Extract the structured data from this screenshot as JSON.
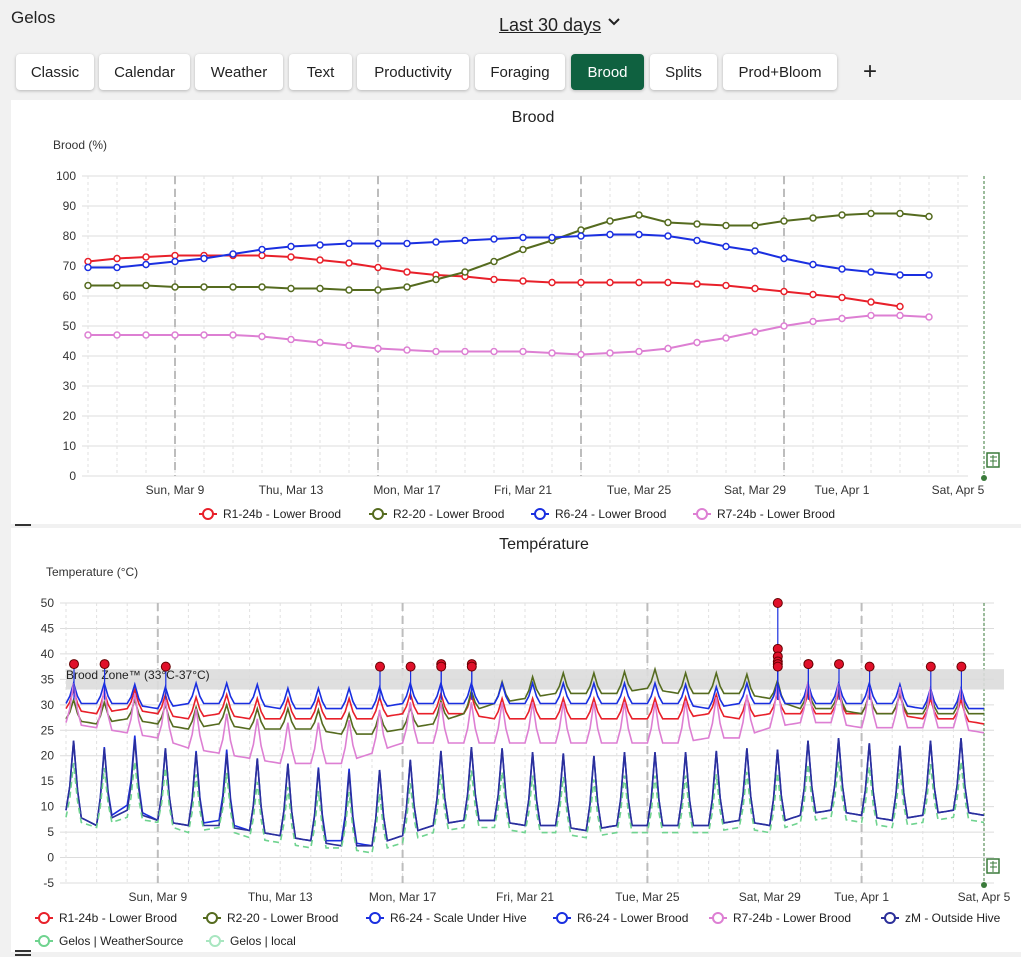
{
  "apiary_name": "Gelos",
  "date_range": {
    "label": "Last 30 days",
    "icon": "chevron-down-icon"
  },
  "tabs": [
    {
      "label": "Classic",
      "active": false
    },
    {
      "label": "Calendar",
      "active": false
    },
    {
      "label": "Weather",
      "active": false
    },
    {
      "label": "Text",
      "active": false
    },
    {
      "label": "Productivity",
      "active": false
    },
    {
      "label": "Foraging",
      "active": false
    },
    {
      "label": "Brood",
      "active": true
    },
    {
      "label": "Splits",
      "active": false
    },
    {
      "label": "Prod+Bloom",
      "active": false
    }
  ],
  "add_tab_icon": "plus-icon",
  "colors": {
    "active_tab": "#0f6140",
    "red": "#e8202a",
    "olive": "#556b1f",
    "blue": "#1a2fe0",
    "pink": "#dd7fd3",
    "navy": "#2b2f9a",
    "lightgreen": "#6fd38f",
    "palegreen": "#a8e6c0"
  },
  "chart_data": [
    {
      "type": "line",
      "title": "Brood",
      "ylabel": "Brood (%)",
      "xlabel": "",
      "ylim": [
        0,
        100
      ],
      "yticks": [
        0,
        10,
        20,
        30,
        40,
        50,
        60,
        70,
        80,
        90,
        100
      ],
      "grid": true,
      "legend_position": "bottom",
      "x_tick_labels": [
        "Sun, Mar 9",
        "Thu, Mar 13",
        "Mon, Mar 17",
        "Fri, Mar 21",
        "Tue, Mar 25",
        "Sat, Mar 29",
        "Tue, Apr 1",
        "Sat, Apr 5"
      ],
      "x": [
        "Mar 6",
        "Mar 7",
        "Mar 8",
        "Mar 9",
        "Mar 10",
        "Mar 11",
        "Mar 12",
        "Mar 13",
        "Mar 14",
        "Mar 15",
        "Mar 16",
        "Mar 17",
        "Mar 18",
        "Mar 19",
        "Mar 20",
        "Mar 21",
        "Mar 22",
        "Mar 23",
        "Mar 24",
        "Mar 25",
        "Mar 26",
        "Mar 27",
        "Mar 28",
        "Mar 29",
        "Mar 30",
        "Mar 31",
        "Apr 1",
        "Apr 2",
        "Apr 3",
        "Apr 4",
        "Apr 5"
      ],
      "series": [
        {
          "name": "R1-24b - Lower Brood",
          "color": "#e8202a",
          "values": [
            71.5,
            72.5,
            73,
            73.5,
            73.5,
            73.5,
            73.5,
            73,
            72,
            71,
            69.5,
            68,
            67,
            66.5,
            65.5,
            65,
            64.5,
            64.5,
            64.5,
            64.5,
            64.5,
            64,
            63.5,
            62.5,
            61.5,
            60.5,
            59.5,
            58,
            56.5,
            null,
            null
          ]
        },
        {
          "name": "R2-20 - Lower Brood",
          "color": "#556b1f",
          "values": [
            63.5,
            63.5,
            63.5,
            63,
            63,
            63,
            63,
            62.5,
            62.5,
            62,
            62,
            63,
            65.5,
            68,
            71.5,
            75.5,
            78.5,
            82,
            85,
            87,
            84.5,
            84,
            83.5,
            83.5,
            85,
            86,
            87,
            87.5,
            87.5,
            86.5,
            null
          ]
        },
        {
          "name": "R6-24 - Lower Brood",
          "color": "#1a2fe0",
          "values": [
            69.5,
            69.5,
            70.5,
            71.5,
            72.5,
            74,
            75.5,
            76.5,
            77,
            77.5,
            77.5,
            77.5,
            78,
            78.5,
            79,
            79.5,
            79.5,
            80,
            80.5,
            80.5,
            80,
            78.5,
            76.5,
            75,
            72.5,
            70.5,
            69,
            68,
            67,
            67,
            null
          ]
        },
        {
          "name": "R7-24b - Lower Brood",
          "color": "#dd7fd3",
          "values": [
            47,
            47,
            47,
            47,
            47,
            47,
            46.5,
            45.5,
            44.5,
            43.5,
            42.5,
            42,
            41.5,
            41.5,
            41.5,
            41.5,
            41,
            40.5,
            41,
            41.5,
            42.5,
            44.5,
            46,
            48,
            50,
            51.5,
            52.5,
            53.5,
            53.5,
            53,
            null
          ]
        }
      ]
    },
    {
      "type": "line",
      "title": "Température",
      "ylabel": "Temperature (°C)",
      "xlabel": "",
      "ylim": [
        -5,
        50
      ],
      "yticks": [
        -5,
        0,
        5,
        10,
        15,
        20,
        25,
        30,
        35,
        40,
        45,
        50
      ],
      "grid": true,
      "legend_position": "bottom",
      "x_tick_labels": [
        "Sun, Mar 9",
        "Thu, Mar 13",
        "Mon, Mar 17",
        "Fri, Mar 21",
        "Tue, Mar 25",
        "Sat, Mar 29",
        "Tue, Apr 1",
        "Sat, Apr 5"
      ],
      "annotation": "Brood Zone™ (33°C-37°C)",
      "brood_zone": [
        33,
        37
      ],
      "x": [
        "Mar 6",
        "Mar 7",
        "Mar 8",
        "Mar 9",
        "Mar 10",
        "Mar 11",
        "Mar 12",
        "Mar 13",
        "Mar 14",
        "Mar 15",
        "Mar 16",
        "Mar 17",
        "Mar 18",
        "Mar 19",
        "Mar 20",
        "Mar 21",
        "Mar 22",
        "Mar 23",
        "Mar 24",
        "Mar 25",
        "Mar 26",
        "Mar 27",
        "Mar 28",
        "Mar 29",
        "Mar 30",
        "Mar 31",
        "Apr 1",
        "Apr 2",
        "Apr 3",
        "Apr 4",
        "Apr 5"
      ],
      "series": [
        {
          "name": "R1-24b - Lower Brood",
          "color": "#e8202a",
          "values": [
            30,
            29,
            30,
            29,
            28,
            29,
            28,
            28,
            28,
            28,
            28,
            29,
            29,
            29,
            28,
            28,
            28,
            28,
            28,
            28,
            28,
            29,
            28,
            29,
            29,
            29,
            29,
            29,
            28,
            28,
            27
          ]
        },
        {
          "name": "R2-20 - Lower Brood",
          "color": "#556b1f",
          "values": [
            28,
            27,
            28,
            27,
            26,
            27,
            26,
            26,
            26,
            25,
            25,
            26,
            27,
            29,
            31,
            32,
            33,
            33,
            33,
            34,
            33,
            33,
            33,
            32,
            30,
            30,
            29,
            29,
            29,
            29,
            29
          ]
        },
        {
          "name": "R6-24 - Scale Under Hive",
          "color": "#1a2fe0",
          "values": [
            12,
            9,
            13,
            10,
            9,
            10,
            8,
            7,
            6,
            6,
            5,
            7,
            9,
            10,
            10,
            9,
            9,
            8,
            9,
            9,
            9,
            9,
            10,
            9,
            11,
            12,
            11,
            10,
            11,
            12,
            11
          ]
        },
        {
          "name": "R6-24 - Lower Brood",
          "color": "#1a2fe0",
          "values": [
            31,
            31,
            31,
            30,
            31,
            31,
            31,
            30,
            30,
            30,
            30,
            31,
            31,
            31,
            31,
            31,
            31,
            31,
            31,
            31,
            31,
            30,
            31,
            31,
            31,
            31,
            31,
            31,
            30,
            30,
            30
          ]
        },
        {
          "name": "R7-24b - Lower Brood",
          "color": "#dd7fd3",
          "values": [
            28,
            27,
            26,
            25,
            23,
            22,
            21,
            20,
            20,
            20,
            22,
            24,
            24,
            24,
            24,
            24,
            24,
            24,
            24,
            24,
            24,
            25,
            25,
            27,
            28,
            28,
            27,
            27,
            27,
            27,
            26
          ]
        },
        {
          "name": "zM - Outside Hive",
          "color": "#2b2f9a",
          "values": [
            12,
            9,
            12,
            10,
            9,
            9,
            8,
            7,
            6,
            5,
            5,
            7,
            9,
            10,
            10,
            9,
            9,
            8,
            9,
            9,
            9,
            9,
            10,
            9,
            11,
            12,
            11,
            10,
            11,
            12,
            11
          ]
        },
        {
          "name": "Gelos | WeatherSource",
          "color": "#6fd38f",
          "values": [
            10,
            8,
            10,
            9,
            7,
            8,
            6,
            5,
            4,
            4,
            3,
            5,
            7,
            8,
            8,
            7,
            7,
            6,
            7,
            7,
            7,
            7,
            8,
            7,
            9,
            10,
            9,
            8,
            9,
            10,
            9
          ]
        },
        {
          "name": "Gelos | local",
          "color": "#a8e6c0",
          "values": [
            null,
            null,
            null,
            null,
            null,
            null,
            null,
            null,
            null,
            null,
            null,
            null,
            null,
            null,
            null,
            null,
            null,
            null,
            null,
            null,
            null,
            null,
            null,
            null,
            null,
            null,
            null,
            null,
            null,
            null,
            null
          ]
        }
      ],
      "alerts": [
        {
          "x": "Mar 6",
          "y": 38
        },
        {
          "x": "Mar 7",
          "y": 38
        },
        {
          "x": "Mar 9",
          "y": 37.5
        },
        {
          "x": "Mar 16",
          "y": 37.5
        },
        {
          "x": "Mar 17",
          "y": 37.5
        },
        {
          "x": "Mar 18",
          "y": 38
        },
        {
          "x": "Mar 18",
          "y": 37.5
        },
        {
          "x": "Mar 19",
          "y": 38
        },
        {
          "x": "Mar 19",
          "y": 37.5
        },
        {
          "x": "Mar 29",
          "y": 50
        },
        {
          "x": "Mar 29",
          "y": 41
        },
        {
          "x": "Mar 29",
          "y": 39.5
        },
        {
          "x": "Mar 29",
          "y": 38.5
        },
        {
          "x": "Mar 29",
          "y": 38
        },
        {
          "x": "Mar 29",
          "y": 37.5
        },
        {
          "x": "Mar 30",
          "y": 38
        },
        {
          "x": "Mar 30",
          "y": 38
        },
        {
          "x": "Mar 31",
          "y": 38
        },
        {
          "x": "Apr 1",
          "y": 37.5
        },
        {
          "x": "Apr 3",
          "y": 37.5
        },
        {
          "x": "Apr 4",
          "y": 37.5
        }
      ]
    }
  ]
}
